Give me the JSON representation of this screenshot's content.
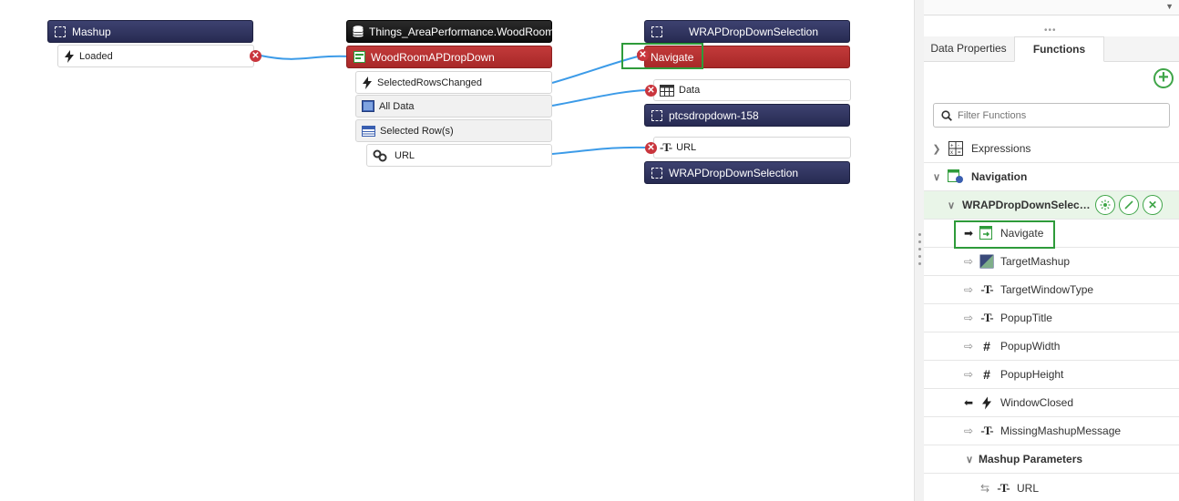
{
  "canvas": {
    "mashup_node": {
      "title": "Mashup",
      "event": "Loaded"
    },
    "things_node": {
      "title": "Things_AreaPerformance.WoodRoom",
      "service": "WoodRoomAPDropDown",
      "events": [
        "SelectedRowsChanged"
      ],
      "all_data": "All Data",
      "selected_rows": "Selected Row(s)",
      "url": "URL"
    },
    "target_node": {
      "title": "WRAPDropDownSelection",
      "service": "Navigate",
      "data_label": "Data",
      "dropdown": "ptcsdropdown-158",
      "url": "URL",
      "bottom_title": "WRAPDropDownSelection"
    },
    "link_color": "#3c9be8"
  },
  "panel": {
    "tabs": [
      {
        "label": "Data Properties",
        "active": false
      },
      {
        "label": "Functions",
        "active": true
      }
    ],
    "filter_placeholder": "Filter Functions",
    "tree": [
      {
        "label": "Expressions",
        "level": 0,
        "icon": "expression-icon",
        "expander": "collapsed"
      },
      {
        "label": "Navigation",
        "level": 0,
        "icon": "navigation-icon",
        "expander": "expanded",
        "bold": true
      },
      {
        "label": "WRAPDropDownSelec…",
        "level": 1,
        "icon": "",
        "expander": "expanded",
        "bold": true,
        "highlight": true
      },
      {
        "label": "Navigate",
        "level": 2,
        "icon": "navigate-service-icon",
        "direction": "service"
      },
      {
        "label": "TargetMashup",
        "level": 2,
        "icon": "mashup-icon",
        "direction": "in"
      },
      {
        "label": "TargetWindowType",
        "level": 2,
        "icon": "string-icon",
        "direction": "in"
      },
      {
        "label": "PopupTitle",
        "level": 2,
        "icon": "string-icon",
        "direction": "in"
      },
      {
        "label": "PopupWidth",
        "level": 2,
        "icon": "number-icon",
        "direction": "in"
      },
      {
        "label": "PopupHeight",
        "level": 2,
        "icon": "number-icon",
        "direction": "in"
      },
      {
        "label": "WindowClosed",
        "level": 2,
        "icon": "event-icon",
        "direction": "out"
      },
      {
        "label": "MissingMashupMessage",
        "level": 2,
        "icon": "string-icon",
        "direction": "in"
      },
      {
        "label": "Mashup Parameters",
        "level": 2,
        "icon": "",
        "expander": "expanded",
        "bold": true
      },
      {
        "label": "URL",
        "level": 3,
        "icon": "string-icon",
        "direction": "both"
      }
    ],
    "accent": "#3fa548"
  }
}
